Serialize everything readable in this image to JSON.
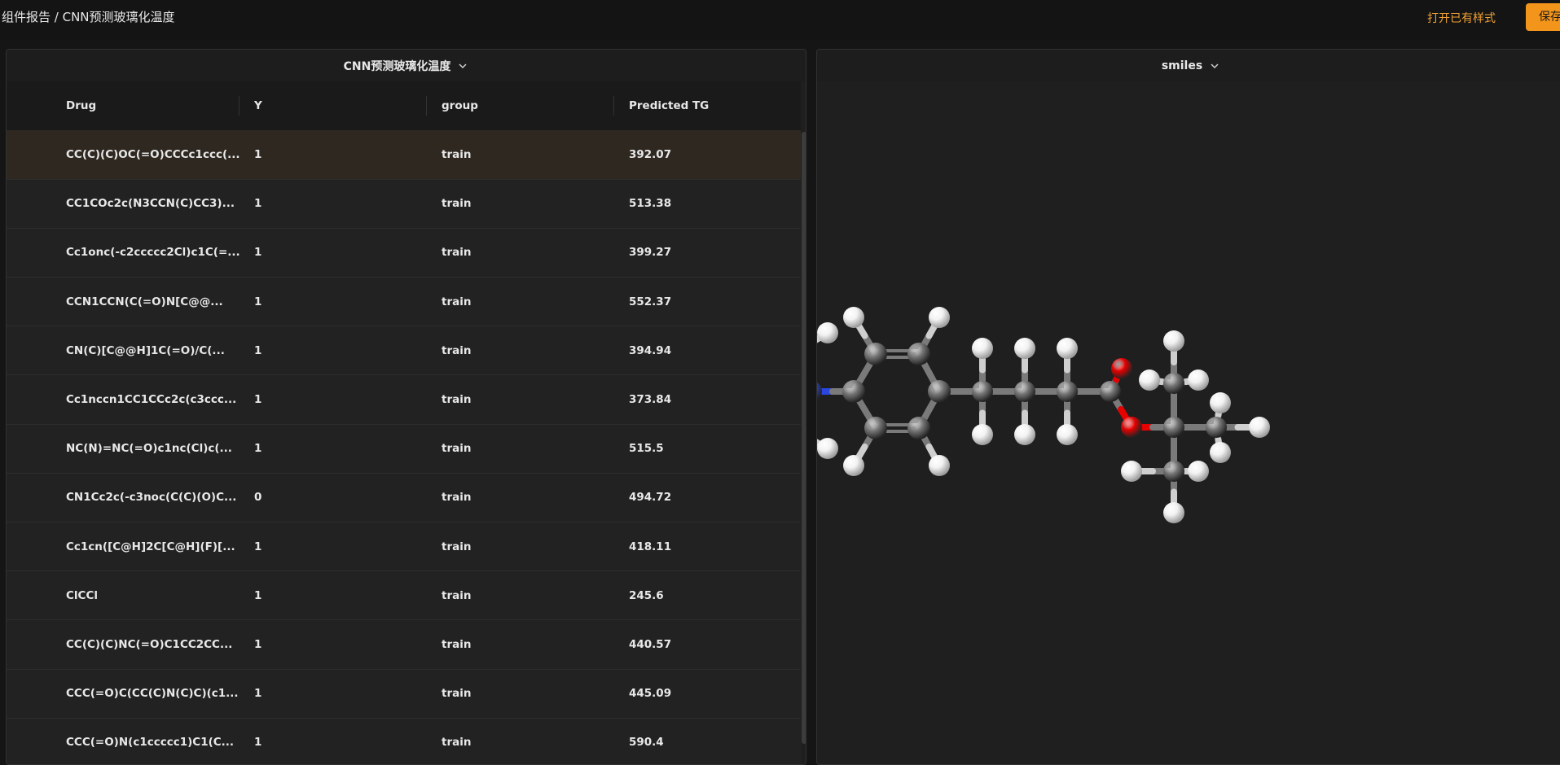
{
  "breadcrumb": "组件报告 / CNN预测玻璃化温度",
  "actions": {
    "open_style": "打开已有样式",
    "save": "保存"
  },
  "left_panel": {
    "title": "CNN预测玻璃化温度",
    "columns": [
      "Drug",
      "Y",
      "group",
      "Predicted TG"
    ],
    "rows": [
      [
        "CC(C)(C)OC(=O)CCCc1ccc(...",
        "1",
        "train",
        "392.07"
      ],
      [
        "CC1COc2c(N3CCN(C)CC3)...",
        "1",
        "train",
        "513.38"
      ],
      [
        "Cc1onc(-c2ccccc2Cl)c1C(=...",
        "1",
        "train",
        "399.27"
      ],
      [
        "CCN1CCN(C(=O)N[C@@...",
        "1",
        "train",
        "552.37"
      ],
      [
        "CN(C)[C@@H]1C(=O)/C(...",
        "1",
        "train",
        "394.94"
      ],
      [
        "Cc1nccn1CC1CCc2c(c3ccc...",
        "1",
        "train",
        "373.84"
      ],
      [
        "NC(N)=NC(=O)c1nc(Cl)c(...",
        "1",
        "train",
        "515.5"
      ],
      [
        "CN1Cc2c(-c3noc(C(C)(O)C...",
        "0",
        "train",
        "494.72"
      ],
      [
        "Cc1cn([C@H]2C[C@H](F)[...",
        "1",
        "train",
        "418.11"
      ],
      [
        "ClCCl",
        "1",
        "train",
        "245.6"
      ],
      [
        "CC(C)(C)NC(=O)C1CC2CC...",
        "1",
        "train",
        "440.57"
      ],
      [
        "CCC(=O)C(CC(C)N(C)C)(c1...",
        "1",
        "train",
        "445.09"
      ],
      [
        "CCC(=O)N(c1ccccc1)C1(C...",
        "1",
        "train",
        "590.4"
      ]
    ]
  },
  "right_panel": {
    "title": "smiles"
  },
  "colors": {
    "accent": "#f3951b",
    "carbon": "#7a7a7a",
    "hydrogen": "#f2f2f2",
    "nitrogen": "#2b46e0",
    "oxygen": "#e60000",
    "chlorine": "#1fd01f"
  }
}
